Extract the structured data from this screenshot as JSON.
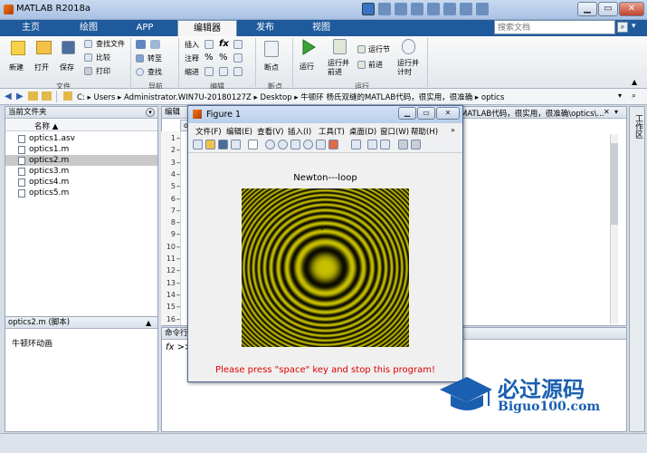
{
  "window": {
    "title": "MATLAB R2018a"
  },
  "tabs": [
    "主页",
    "绘图",
    "APP",
    "编辑器",
    "发布",
    "视图"
  ],
  "active_tab": "编辑器",
  "search": {
    "placeholder": "搜索文档"
  },
  "ribbon": {
    "file": {
      "new": "新建",
      "open": "打开",
      "save": "保存",
      "find_files": "查找文件",
      "compare": "比较",
      "print": "打印",
      "group": "文件"
    },
    "nav": {
      "goto": "转至",
      "find": "查找",
      "group": "导航"
    },
    "edit": {
      "insert": "插入",
      "comment": "注释",
      "indent": "缩进",
      "fx": "fx",
      "group": "编辑"
    },
    "breakpoints": {
      "label": "断点",
      "group": "断点"
    },
    "run": {
      "run": "运行",
      "run_advance": "运行并\n前进",
      "run_section": "运行节",
      "advance": "前进",
      "run_time": "运行并\n计时",
      "group": "运行"
    }
  },
  "address": {
    "path": "C: ▸ Users ▸ Administrator.WIN7U-20180127Z ▸ Desktop ▸ 牛顿环 杨氏双缝的MATLAB代码，很实用，很准确 ▸ optics"
  },
  "current_folder": {
    "title": "当前文件夹",
    "column": "名称 ▲",
    "files": [
      "optics1.asv",
      "optics1.m",
      "optics2.m",
      "optics3.m",
      "optics4.m",
      "optics5.m"
    ],
    "selected_index": 2
  },
  "details": {
    "title": "optics2.m  (脚本)",
    "description": "牛顿环动画"
  },
  "editor": {
    "title": "编辑",
    "path_tail": "MATLAB代码，很实用，很准确\\optics\\...",
    "tab": "op",
    "lines": [
      "1",
      "2",
      "3",
      "4",
      "5",
      "6",
      "7",
      "8",
      "9",
      "10",
      "11",
      "12",
      "13",
      "14",
      "15",
      "16"
    ]
  },
  "command_window": {
    "title": "命令行",
    "prompt": "fx >>"
  },
  "right_strip": {
    "label": "工作区"
  },
  "figure": {
    "title": "Figure 1",
    "menu": [
      "文件(F)",
      "编辑(E)",
      "查看(V)",
      "插入(I)",
      "工具(T)",
      "桌面(D)",
      "窗口(W)",
      "帮助(H)"
    ],
    "plot_title": "Newton---loop",
    "message": "Please press \"space\" key and stop this program!"
  },
  "watermark": {
    "brand": "必过源码",
    "url": "Biguo100.com"
  },
  "colors": {
    "ring_bright": "#c8c000",
    "ring_dark": "#0b0b00",
    "message": "#e00000",
    "tab_bar": "#1f5a9c"
  }
}
